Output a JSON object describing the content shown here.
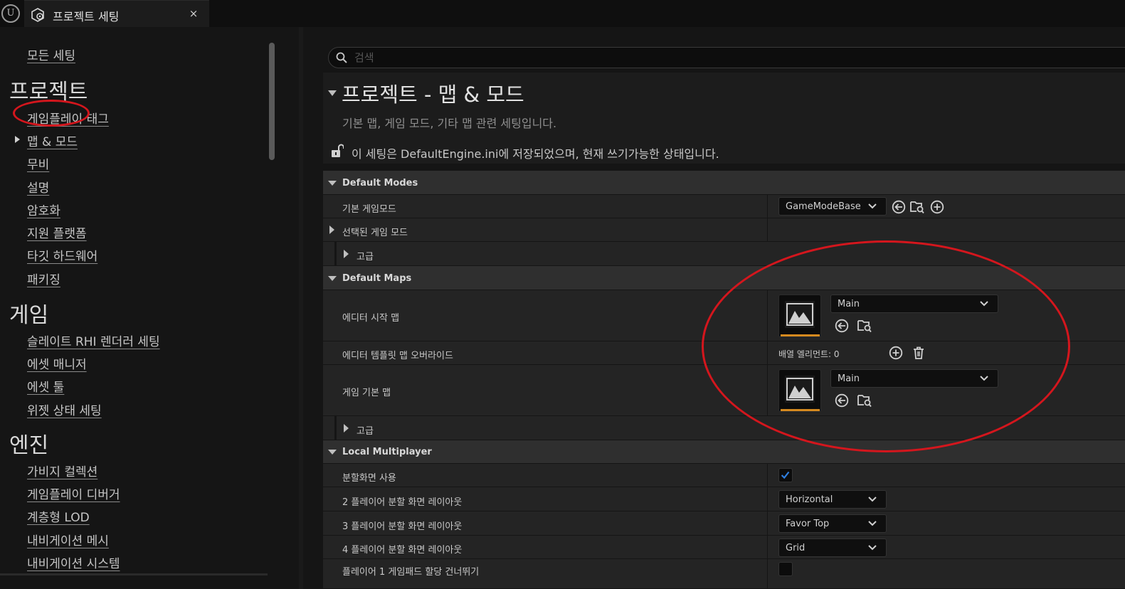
{
  "app": {
    "logo_text": "U",
    "tab_title": "프로젝트 세팅",
    "tab_close": "×"
  },
  "sidebar": {
    "all_settings": "모든 세팅",
    "categories": [
      {
        "title": "프로젝트",
        "items": [
          "게임플레이 태그",
          "맵 & 모드",
          "무비",
          "설명",
          "암호화",
          "지원 플랫폼",
          "타깃 하드웨어",
          "패키징"
        ]
      },
      {
        "title": "게임",
        "items": [
          "슬레이트 RHI 렌더러 세팅",
          "에셋 매니저",
          "에셋 툴",
          "위젯 상태 세팅"
        ]
      },
      {
        "title": "엔진",
        "items": [
          "가비지 컬렉션",
          "게임플레이 디버거",
          "계층형 LOD",
          "내비게이션 메시",
          "내비게이션 시스템"
        ]
      }
    ],
    "active_item": "맵 & 모드"
  },
  "search": {
    "placeholder": "검색"
  },
  "header": {
    "title": "프로젝트 - 맵 & 모드",
    "description": "기본 맵, 게임 모드, 기타 맵 관련 세팅입니다.",
    "config_note": "이 세팅은 DefaultEngine.ini에 저장되었으며, 현재 쓰기가능한 상태입니다."
  },
  "sections": {
    "default_modes": {
      "title": "Default Modes",
      "default_gamemode_label": "기본 게임모드",
      "default_gamemode_value": "GameModeBase",
      "selected_gamemode_label": "선택된 게임 모드",
      "advanced_label": "고급"
    },
    "default_maps": {
      "title": "Default Maps",
      "editor_startup_map_label": "에디터 시작 맵",
      "editor_startup_map_value": "Main",
      "editor_template_override_label": "에디터 템플릿 맵 오버라이드",
      "array_elements_text": "배열 엘리먼트: 0",
      "game_default_map_label": "게임 기본 맵",
      "game_default_map_value": "Main",
      "advanced_label": "고급"
    },
    "local_multiplayer": {
      "title": "Local Multiplayer",
      "use_splitscreen_label": "분할화면 사용",
      "use_splitscreen_checked": true,
      "two_player_label": "2 플레이어 분할 화면 레이아웃",
      "two_player_value": "Horizontal",
      "three_player_label": "3 플레이어 분할 화면 레이아웃",
      "three_player_value": "Favor Top",
      "four_player_label": "4 플레이어 분할 화면 레이아웃",
      "four_player_value": "Grid",
      "skip_gamepad_label": "플레이어 1 게임패드 할당 건너뛰기",
      "skip_gamepad_checked": false
    }
  },
  "colors": {
    "annotation": "#d4161d",
    "checkbox_accent": "#2f7fe0",
    "thumbnail_underline": "#d68a1f"
  }
}
